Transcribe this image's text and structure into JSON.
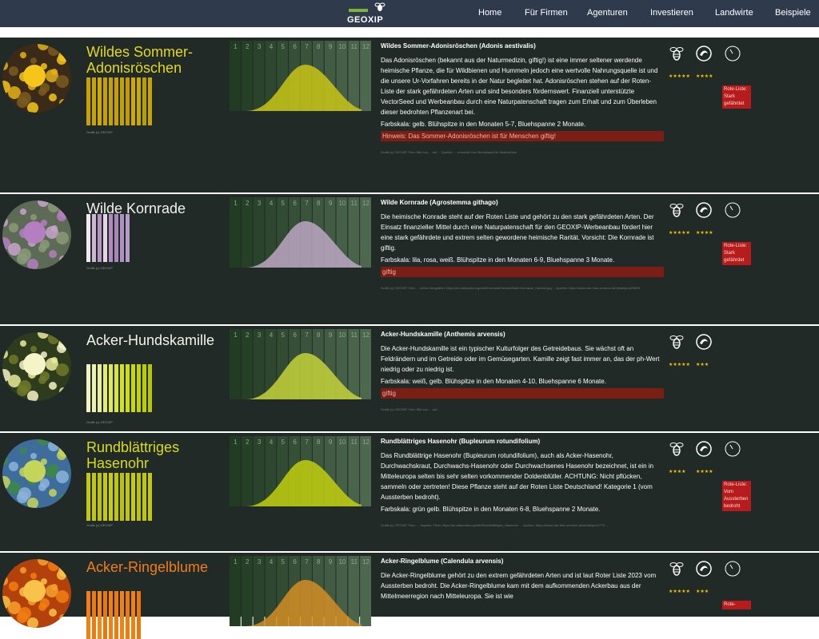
{
  "nav": {
    "logo_text": "GEOXIP",
    "links": [
      "Home",
      "Für Firmen",
      "Agenturen",
      "Investieren",
      "Landwirte",
      "Beispiele"
    ]
  },
  "colors": {
    "accent_gold": "#c6d000",
    "badge_red": "#b71c1c",
    "warn_bg": "#7a1e16",
    "card_bg": "#212a27"
  },
  "cards": [
    {
      "title": "Wildes Sommer-Adonisröschen",
      "title_color": "#e3d91c",
      "credit": "Grafik (c) GEOXIP",
      "months": [
        "1",
        "2",
        "3",
        "4",
        "5",
        "6",
        "7",
        "8",
        "9",
        "10",
        "11",
        "12"
      ],
      "curve_color": "#c9c516",
      "swatch_colors": [
        "#c8a200",
        "#c9a400",
        "#d0a900",
        "#c89f00",
        "#c4a300",
        "#cc9f00",
        "#c0a400",
        "#c79a00",
        "#d2a900",
        "#c8ab00",
        "#b8a000",
        "#c7a500"
      ],
      "heading": "Wildes Sommer-Adonisröschen (Adonis aestivalis)",
      "text": "Das Adonisröschen (bekannt aus der Naturmedizin, giftig!) ist eine immer seltener werdende heimische Pflanze, die für Wildbienen und Hummeln jedoch eine wertvolle Nahrungsquelle ist und die unsere Ur-Vorfahren bereits in der Natur begleitet hat. Adonisröschen stehen auf der Roten-Liste der stark gefährdeten Arten und sind besonders fördernswert. Finanziell unterstützte VectorSeed und Werbeanbau durch eine Naturpatenschaft tragen zum Erhalt und zum Überleben dieser bedrohten Pflanzenart bei.",
      "farbskala": "Farbskala: gelb. Blühspitze in den Monaten 5-7, Bluehspanne 2 Monate.",
      "warning": "Hinweis: Das Sommer-Adonisröschen ist für Menschen giftig!",
      "source": "Grafik (c) GEOXIP, Foto: Bild von ... auf ... Quellen: ... erkundet vom Bundesamt für Naturschutz",
      "stars_bee": "★★★★★",
      "stars_soil": "★★★★",
      "badge": "Rote-Liste: Stark gefährdet"
    },
    {
      "title": "Wilde Kornrade",
      "title_color": "#f1f1f1",
      "credit": "Grafik (c) GEOXIP",
      "months": [
        "1",
        "2",
        "3",
        "4",
        "5",
        "6",
        "7",
        "8",
        "9",
        "10",
        "11",
        "12"
      ],
      "curve_color": "#bda6c3",
      "swatch_colors": [
        "#eee8ef",
        "#cdb6d2",
        "#b594c0",
        "#e5d3e8",
        "#b18bbd",
        "#a985b8",
        "#ad91c3",
        "#b69bc8"
      ],
      "heading": "Wilde Kornrade (Agrostemma githago)",
      "text": "Die heimische Konrade steht auf der Roten Liste und gehört zu den stark gefährdeten Arten. Der Einsatz finanzieller Mittel durch eine Naturpatenschaft für den GEOXIP-Werbeanbau fördert hier eine stark gefährdete und extrem selten gewordene heimische Rarität. Vorsicht: Die Kornrade ist giftig.",
      "farbskala": "Farbskala: lila, rosa, weiß. Blühspitze in den Monaten 6-9, Bluehspanne 3 Monate.",
      "warning": "giftig",
      "source": "Grafik (c) GEOXIP, Foto: ... selbst fotografiert, https://de.wikipedia.org/wiki/Kornrade#/media/Datei:Kornrade_Outdoor.jpg ... Quellen: https://www.rote-liste-zentrum.de/detail/pnd/29825",
      "stars_bee": "★★★★★",
      "stars_soil": "★★★★",
      "badge": "Rote-Liste: Stark gefährdet"
    },
    {
      "title": "Acker-Hundskamille",
      "title_color": "#f3f3e8",
      "credit": "Grafik (c) GEOXIP",
      "months": [
        "1",
        "2",
        "3",
        "4",
        "5",
        "6",
        "7",
        "8",
        "9",
        "10",
        "11",
        "12"
      ],
      "curve_color": "#c6d23a",
      "swatch_colors": [
        "#f1f4c0",
        "#eef0b3",
        "#e8ee9c",
        "#e3eb79",
        "#dde85b",
        "#d8e63c",
        "#d3e21f",
        "#cedf10",
        "#c7d900",
        "#c2d300",
        "#bccd00",
        "#b5c700"
      ],
      "heading": "Acker-Hundskamille (Anthemis arvensis)",
      "text": "Die Acker-Hundskamille ist ein typischer Kulturfolger des Getreidebaus. Sie wächst oft an Feldrändern und im Getreide oder im Gemüsegarten. Kamille zeigt fast immer an, das der ph-Wert niedrig oder zu niedrig ist.",
      "farbskala": "Farbskala: weiß, gelb. Blühspitze in den Monaten 4-10, Bluehspanne 6 Monate.",
      "warning": "giftig",
      "source": "Grafik (c) GEOXIP, Foto: Bild von ... auf ...",
      "stars_bee": "★★★★★",
      "stars_soil": "★★★",
      "badge": ""
    },
    {
      "title": "Rundblättriges Hasenohr",
      "title_color": "#d7dd1d",
      "credit": "Grafik (c) GEOXIP",
      "months": [
        "1",
        "2",
        "3",
        "4",
        "5",
        "6",
        "7",
        "8",
        "9",
        "10",
        "11",
        "12"
      ],
      "curve_color": "#c2cf0e",
      "swatch_colors": [
        "#c4c812",
        "#c1c60e",
        "#bdc20b",
        "#c4c90f",
        "#c7cc12",
        "#bfc50b",
        "#bbc009",
        "#c1c50c",
        "#c6ca10",
        "#bcc10a",
        "#c0c50d",
        "#c3c80f"
      ],
      "heading": "Rundblättriges Hasenohr (Bupleurum rotundifolium)",
      "text": "Das Rundblättrige Hasenohr (Bupleurum rotundifolium), auch als Acker-Hasenohr, Durchwachskraut, Durchwachs-Hasenohr oder Durchwachsenes Hasenohr bezeichnet, ist ein in Mitteleuropa selten bis sehr selten vorkommender Doldenblütler. ACHTUNG: Nicht pflücken, sammeln oder zertreten! Diese Pflanze steht auf der Roten Liste Deutschland! Kategorie 1 (vom Aussterben bedroht).",
      "farbskala": "Farbskala: grün gelb. Blühspitze in den Monaten 6-8, Bluehspanne 2 Monate.",
      "warning": "",
      "source": "Grafik (c) GEOXIP, Foto: ... Jagsem, Flickr, https://de.wikipedia.org/wiki/Rundblättriges_Hasenohr ... Quellen: https://www.rote-liste-zentrum.de/detail/pnd/1770 ...",
      "stars_bee": "★★★★",
      "stars_soil": "★★★★",
      "badge": "Rote-Liste: Vom Aussterben bedroht"
    },
    {
      "title": "Acker-Ringelblume",
      "title_color": "#f07d1a",
      "credit": "",
      "months": [
        "1",
        "2",
        "3",
        "4",
        "5",
        "6",
        "7",
        "8",
        "9",
        "10",
        "11",
        "12"
      ],
      "curve_color": "#d28d25",
      "swatch_colors": [
        "#f27f12",
        "#ee7a0e",
        "#f38614",
        "#e9770c",
        "#f08012",
        "#ec7c10",
        "#f18313",
        "#ed7b0f",
        "#ef8012",
        "#ea770d"
      ],
      "heading": "Acker-Ringelblume (Calendula arvensis)",
      "text": "Die Acker-Ringelblume gehört zu den extrem gefährdeten Arten und ist laut Roter Liste 2023 vom Aussterben bedroht. Die Acker-Ringelblume kam mit dem aufkommenden Ackerbau aus der Mittelmeerregion nach Mitteleuropa. Sie ist wie",
      "farbskala": "",
      "warning": "",
      "source": "",
      "stars_bee": "★★★★★",
      "stars_soil": "★★★",
      "badge": "Rote-"
    }
  ]
}
